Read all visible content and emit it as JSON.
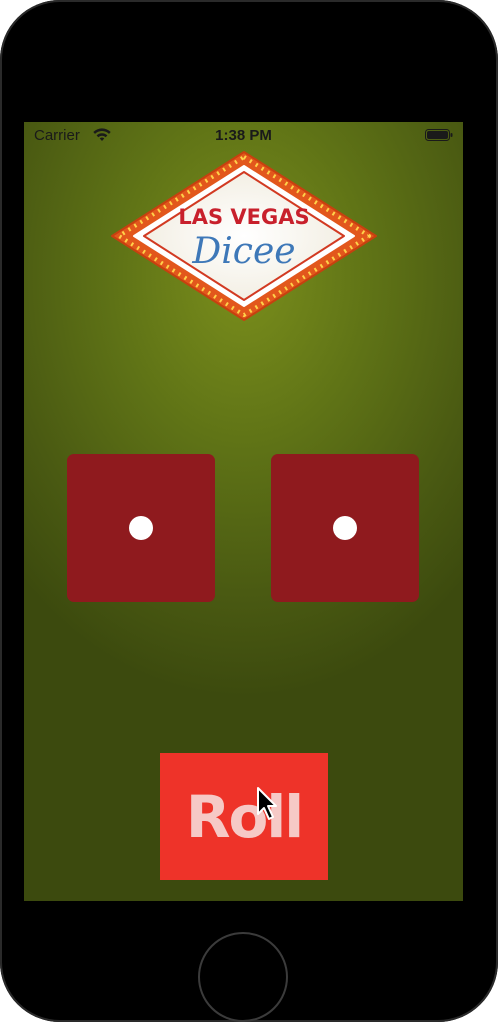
{
  "status_bar": {
    "carrier": "Carrier",
    "time": "1:38 PM",
    "wifi_icon": "wifi-icon",
    "battery_icon": "battery-icon"
  },
  "logo": {
    "line1": "LAS VEGAS",
    "line2": "Dicee"
  },
  "dice": [
    {
      "value": 1
    },
    {
      "value": 1
    }
  ],
  "roll_button": {
    "label": "Roll"
  },
  "colors": {
    "background": "#5f7316",
    "dice": "#8f1a1e",
    "pip": "#ffffff",
    "button": "#ee3329",
    "button_text": "#f6c9c6"
  }
}
